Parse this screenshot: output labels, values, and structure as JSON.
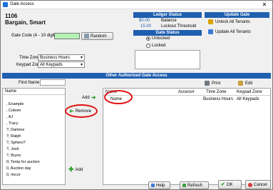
{
  "window": {
    "title": "Gate Access",
    "close_glyph": "✕"
  },
  "tenant": {
    "id": "1106",
    "name": "Bargain, Smart"
  },
  "form": {
    "gate_code_label": "Gate Code (4 - 10 digits)",
    "gate_code_value": "",
    "random_label": "Random",
    "time_zone_label": "Time Zone",
    "time_zone_value": "Business Hours",
    "keypad_zone_label": "Keypad Zone",
    "keypad_zone_value": "All Keypads"
  },
  "ledger": {
    "title": "Ledger Status",
    "balance_amount": "$0.00",
    "balance_label": "Balance",
    "lockout_amount": "15.00",
    "lockout_label": "Lockout Threshold"
  },
  "gate_status": {
    "title": "Gate Status",
    "unlocked_label": "Unlocked",
    "locked_label": "Locked",
    "selected": "Unlocked"
  },
  "update_gate": {
    "title": "Update Gate",
    "unlock_all": "Unlock All Tenants",
    "update_all": "Update All Tenants"
  },
  "other_access": {
    "title": "Other Authorized Gate Access",
    "find_name_label": "Find Name",
    "find_name_value": "",
    "list_header": "Name",
    "tenants": [
      ", Example",
      ", Coleen",
      ", AJ",
      ", Tracy",
      "?, Darlene",
      "?, Ralph",
      "?, Sphero?",
      "?, Josh",
      "?, Brynn",
      "0, Temp for auction",
      "0, Auction day",
      "0, Imcor"
    ],
    "add_top": "Add",
    "remove": "Remove",
    "add_bottom": "Add",
    "print": "Print",
    "edit": "Edit",
    "grid_headers": {
      "name": "Name",
      "access": "Access#",
      "time_zone": "Time Zone",
      "keypad_zone": "Keypad Zone"
    },
    "grid_rows": [
      {
        "name": "Name",
        "access": "",
        "time_zone": "Business Hours",
        "keypad_zone": "All Keypads"
      }
    ]
  },
  "footer": {
    "help": "Help",
    "refresh": "Refresh",
    "ok": "OK",
    "cancel": "Cancel"
  },
  "colors": {
    "header_blue": "#1f5fb0",
    "gate_code_green": "#b4f0b4",
    "annotation_red": "#e01010"
  }
}
